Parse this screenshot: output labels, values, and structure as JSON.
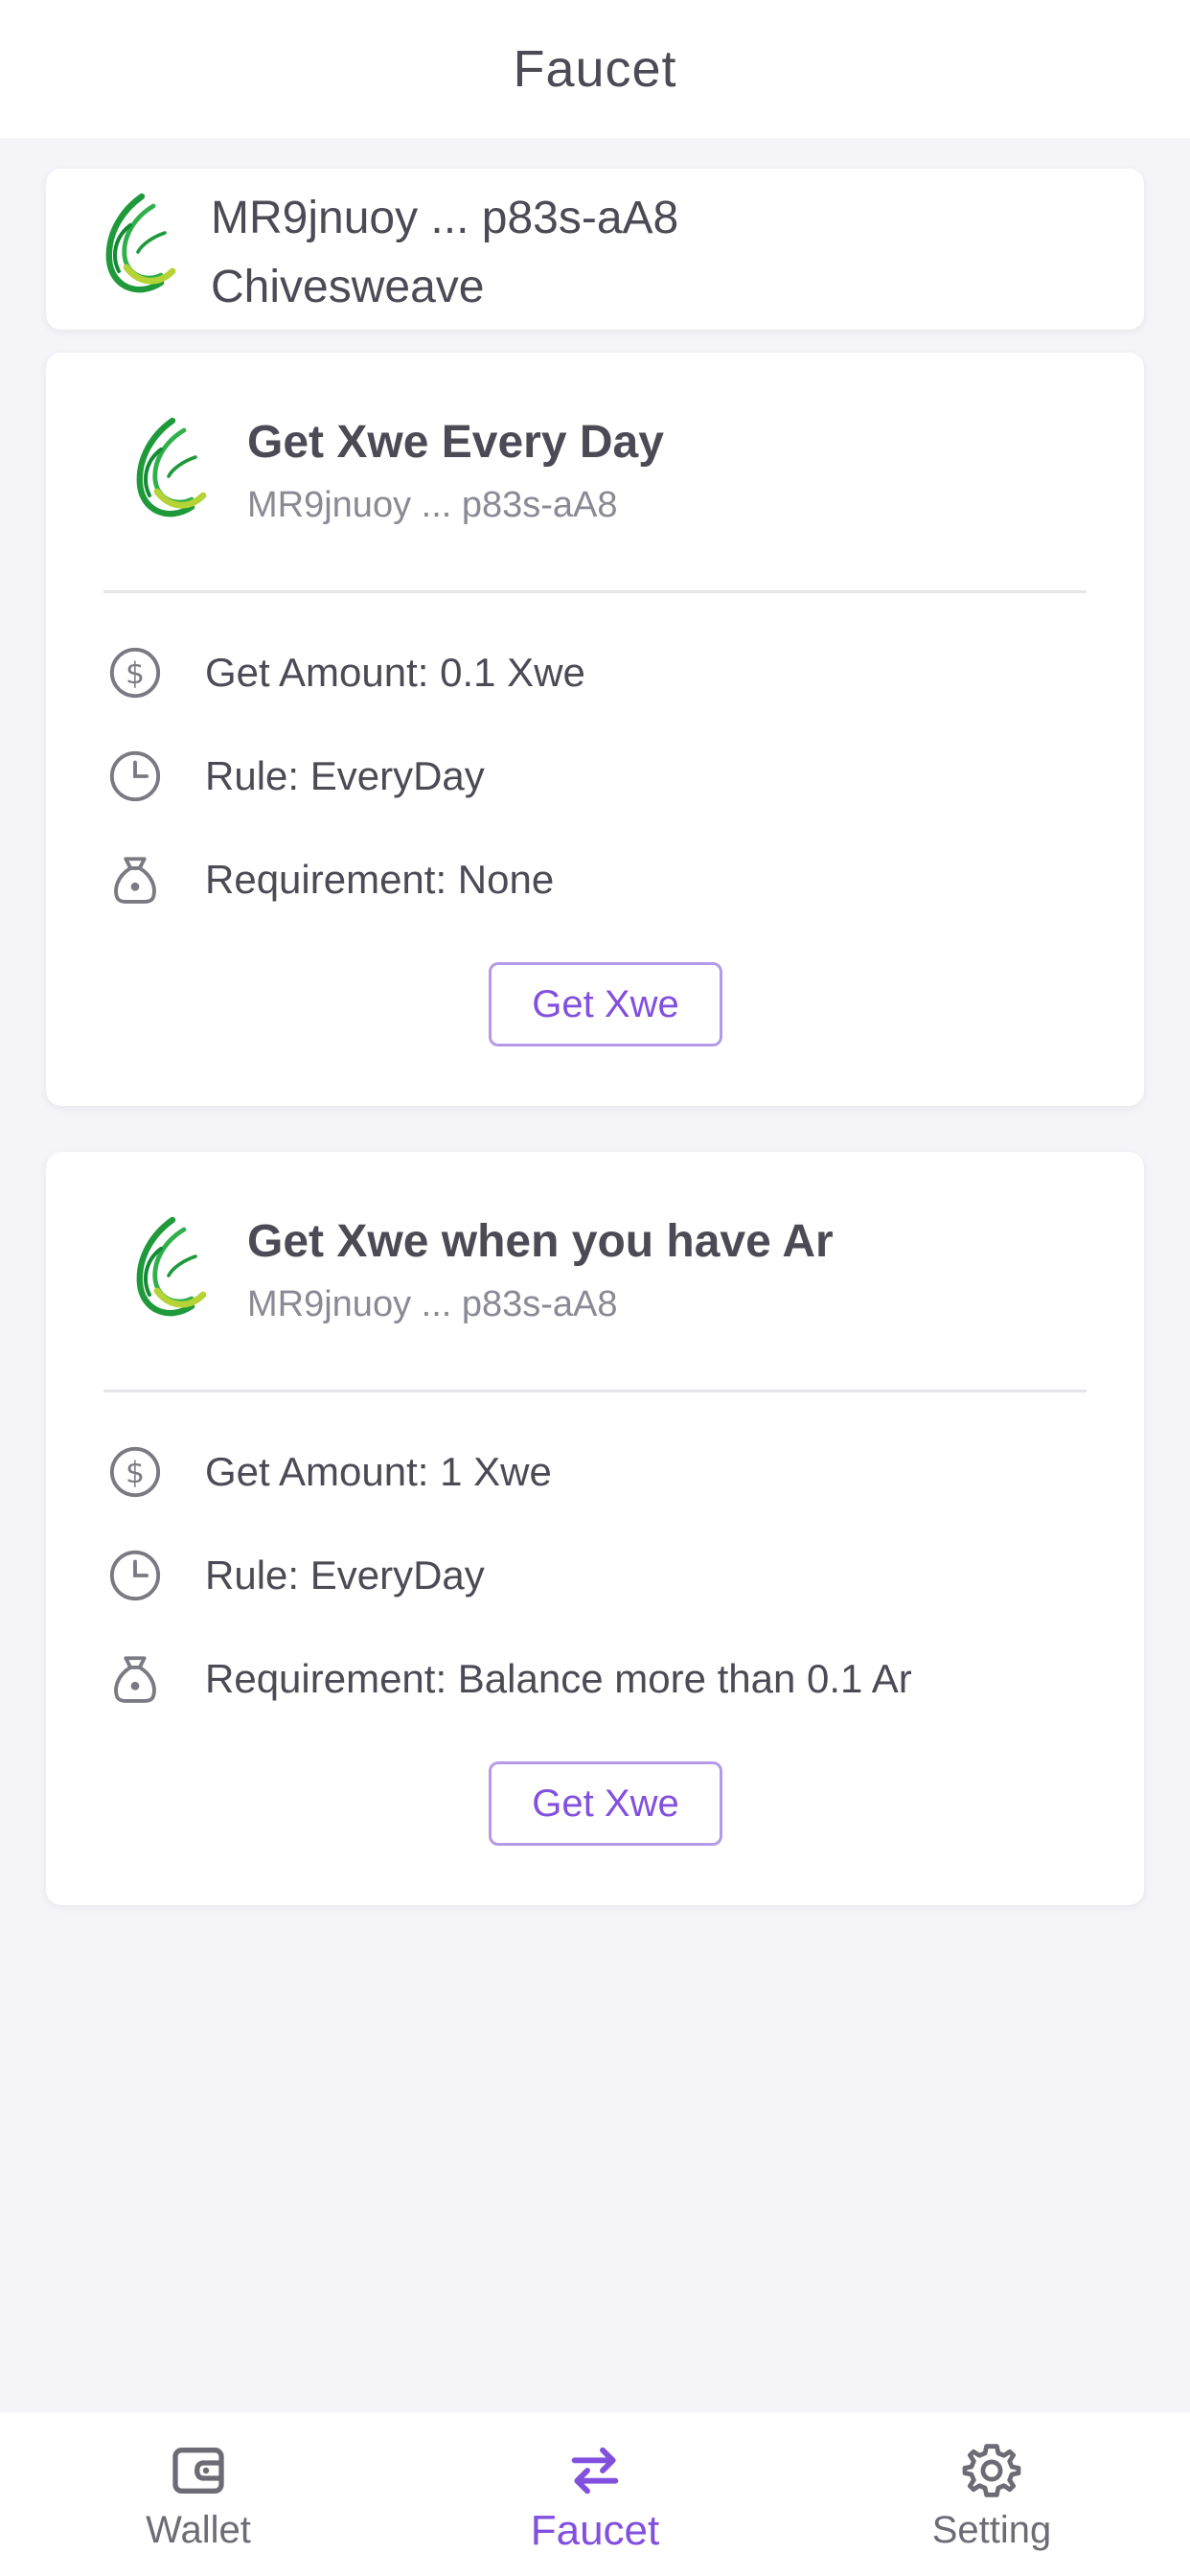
{
  "header": {
    "title": "Faucet"
  },
  "account": {
    "address": "MR9jnuoy ... p83s-aA8",
    "chain": "Chivesweave",
    "logo_icon": "chivesweave-logo"
  },
  "faucets": [
    {
      "title": "Get Xwe Every Day",
      "address": "MR9jnuoy ... p83s-aA8",
      "amount": "Get Amount: 0.1 Xwe",
      "rule": "Rule: EveryDay",
      "requirement": "Requirement: None",
      "button": "Get Xwe"
    },
    {
      "title": "Get Xwe when you have Ar",
      "address": "MR9jnuoy ... p83s-aA8",
      "amount": "Get Amount: 1 Xwe",
      "rule": "Rule: EveryDay",
      "requirement": "Requirement: Balance more than 0.1 Ar",
      "button": "Get Xwe"
    }
  ],
  "nav": {
    "items": [
      {
        "label": "Wallet",
        "icon": "wallet-icon",
        "active": false
      },
      {
        "label": "Faucet",
        "icon": "swap-arrows-icon",
        "active": true
      },
      {
        "label": "Setting",
        "icon": "gear-icon",
        "active": false
      }
    ]
  },
  "colors": {
    "accent": "#8250df",
    "background": "#f4f4f9",
    "card": "#ffffff",
    "text": "#4c4b55",
    "muted": "#8a8a95",
    "logo_green": "#1f9a3a",
    "logo_lime": "#b5d334"
  }
}
